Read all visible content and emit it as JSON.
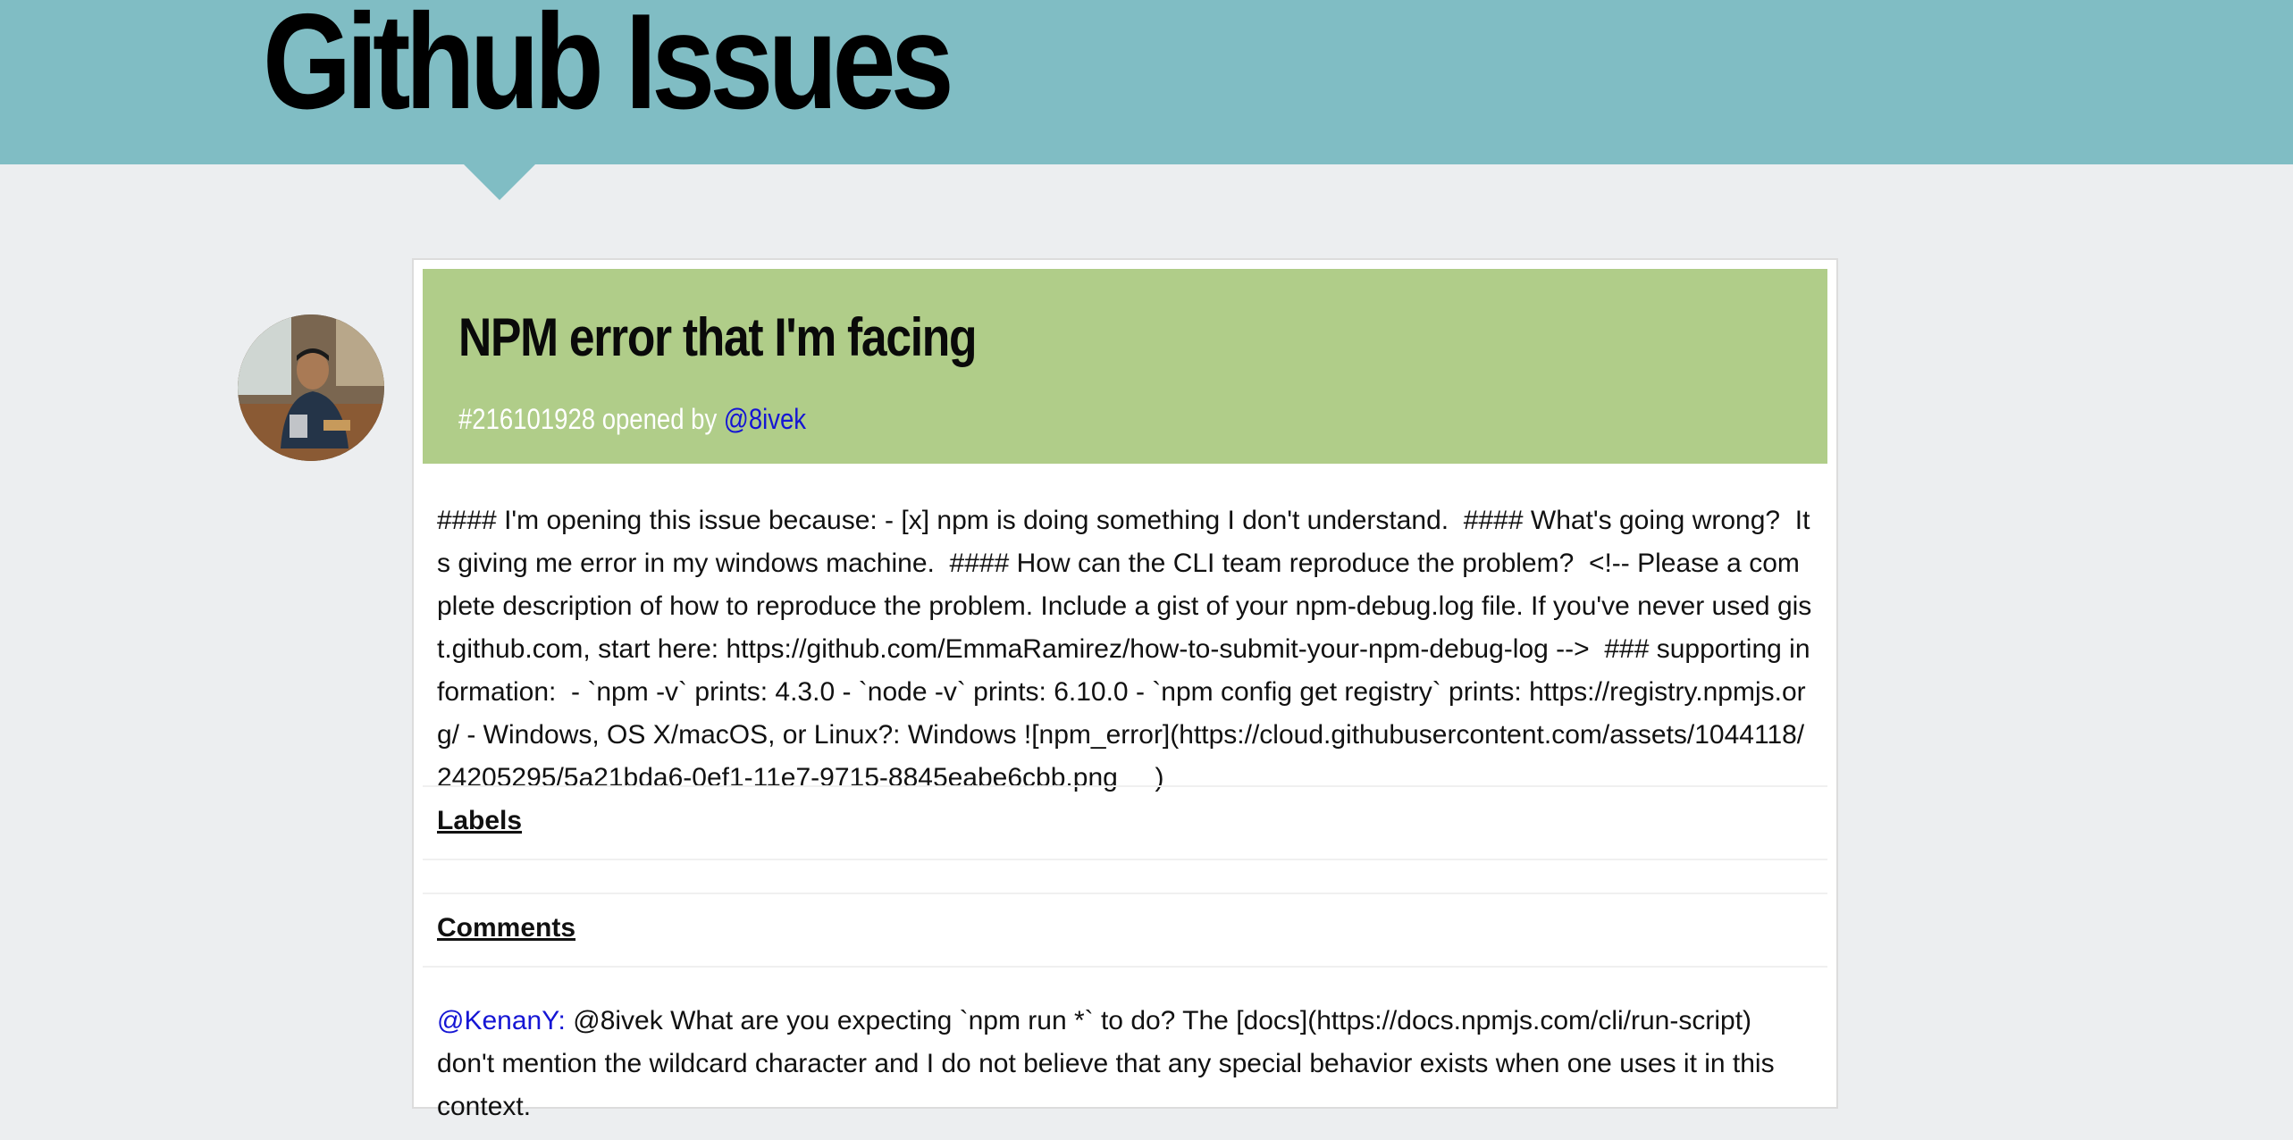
{
  "site": {
    "title": "Github Issues",
    "accent_color": "#80bdc4"
  },
  "issue": {
    "avatar_icon": "user-avatar-photo",
    "title": "NPM error that I'm facing",
    "number": "#216101928",
    "opened_by_text": "opened by",
    "author": "@8ivek",
    "header_color": "#b0cd89",
    "body": "#### I'm opening this issue because: - [x] npm is doing something I don't understand.  #### What's going wrong?  Its giving me error in my windows machine.  #### How can the CLI team reproduce the problem?  <!-- Please a complete description of how to reproduce the problem. Include a gist of your npm-debug.log file. If you've never used gist.github.com, start here: https://github.com/EmmaRamirez/how-to-submit-your-npm-debug-log -->  ### supporting information:  - `npm -v` prints: 4.3.0 - `node -v` prints: 6.10.0 - `npm config get registry` prints: https://registry.npmjs.org/ - Windows, OS X/macOS, or Linux?: Windows ![npm_error](https://cloud.githubusercontent.com/assets/1044118/24205295/5a21bda6-0ef1-11e7-9715-8845eabe6cbb.png     )"
  },
  "labels": {
    "heading": "Labels"
  },
  "comments": {
    "heading": "Comments",
    "items": [
      {
        "author": "@KenanY:",
        "text": "@8ivek What are you expecting `npm run *` to do? The [docs](https://docs.npmjs.com/cli/run-script) don't mention the wildcard character and I do not believe that any special behavior exists when one uses it in this context."
      }
    ]
  }
}
